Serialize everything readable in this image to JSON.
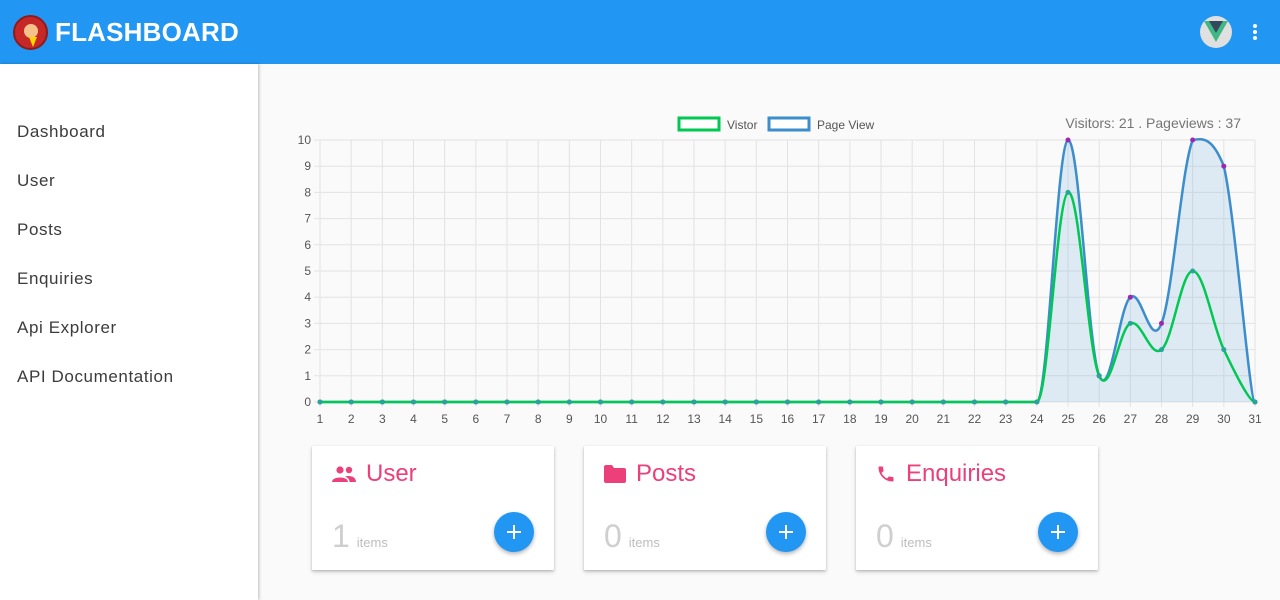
{
  "app": {
    "title": "FLASHBOARD"
  },
  "sidebar": {
    "items": [
      {
        "label": "Dashboard"
      },
      {
        "label": "User"
      },
      {
        "label": "Posts"
      },
      {
        "label": "Enquiries"
      },
      {
        "label": "Api Explorer"
      },
      {
        "label": "API Documentation"
      }
    ]
  },
  "stats": {
    "summary": "Visitors: 21 . Pageviews : 37"
  },
  "chart_data": {
    "type": "line",
    "x": [
      1,
      2,
      3,
      4,
      5,
      6,
      7,
      8,
      9,
      10,
      11,
      12,
      13,
      14,
      15,
      16,
      17,
      18,
      19,
      20,
      21,
      22,
      23,
      24,
      25,
      26,
      27,
      28,
      29,
      30,
      31
    ],
    "ylim": [
      0,
      10
    ],
    "yticks": [
      0,
      1,
      2,
      3,
      4,
      5,
      6,
      7,
      8,
      9,
      10
    ],
    "grid": true,
    "legend": "top-center",
    "series": [
      {
        "name": "Vistor",
        "color": "#00c853",
        "values": [
          0,
          0,
          0,
          0,
          0,
          0,
          0,
          0,
          0,
          0,
          0,
          0,
          0,
          0,
          0,
          0,
          0,
          0,
          0,
          0,
          0,
          0,
          0,
          0,
          8,
          1,
          3,
          2,
          5,
          2,
          0
        ]
      },
      {
        "name": "Page View",
        "color": "#3c8dcc",
        "values": [
          0,
          0,
          0,
          0,
          0,
          0,
          0,
          0,
          0,
          0,
          0,
          0,
          0,
          0,
          0,
          0,
          0,
          0,
          0,
          0,
          0,
          0,
          0,
          0,
          10,
          1,
          4,
          3,
          10,
          9,
          0
        ]
      }
    ]
  },
  "cards": [
    {
      "title": "User",
      "count": "1",
      "unit": "items",
      "icon": "people-icon"
    },
    {
      "title": "Posts",
      "count": "0",
      "unit": "items",
      "icon": "folder-icon"
    },
    {
      "title": "Enquiries",
      "count": "0",
      "unit": "items",
      "icon": "phone-icon"
    }
  ],
  "colors": {
    "primary": "#2196f3",
    "accent": "#ec407a"
  }
}
